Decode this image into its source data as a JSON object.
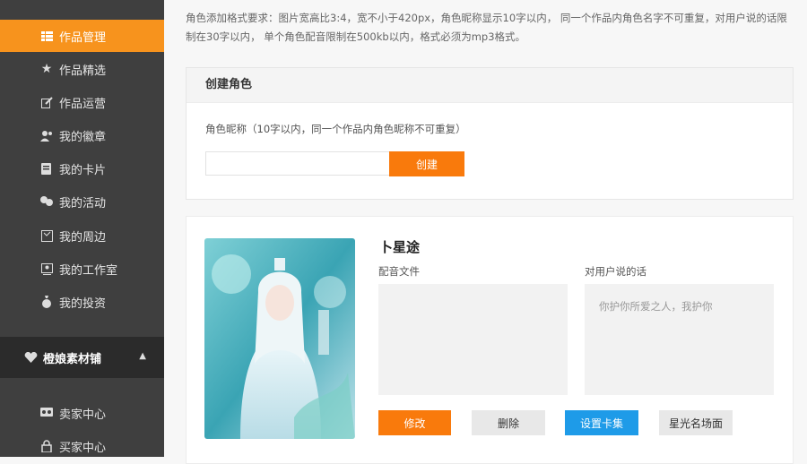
{
  "sidebar": {
    "items": [
      {
        "label": "作品管理",
        "icon": "grid-list-icon",
        "active": true
      },
      {
        "label": "作品精选",
        "icon": "star-icon"
      },
      {
        "label": "作品运营",
        "icon": "edit-icon"
      },
      {
        "label": "我的徽章",
        "icon": "badge-icon"
      },
      {
        "label": "我的卡片",
        "icon": "card-icon"
      },
      {
        "label": "我的活动",
        "icon": "activity-icon"
      },
      {
        "label": "我的周边",
        "icon": "merch-icon"
      },
      {
        "label": "我的工作室",
        "icon": "studio-icon"
      },
      {
        "label": "我的投资",
        "icon": "money-bag-icon"
      }
    ],
    "section": {
      "label": "橙娘素材铺",
      "icon": "heart-icon",
      "caret": "▲"
    },
    "sub_items": [
      {
        "label": "卖家中心",
        "icon": "seller-icon"
      },
      {
        "label": "买家中心",
        "icon": "lock-icon"
      }
    ],
    "accent_color": "#f7931d"
  },
  "main": {
    "note": "角色添加格式要求：图片宽高比3:4，宽不小于420px，角色昵称显示10字以内，  同一个作品内角色名字不可重复，对用户说的话限制在30字以内，  单个角色配音限制在500kb以内，格式必须为mp3格式。",
    "create_panel": {
      "title": "创建角色",
      "field_label": "角色昵称（10字以内，同一个作品内角色昵称不可重复）",
      "input_value": "",
      "button_label": "创建"
    },
    "role": {
      "name": "卜星途",
      "audio_label": "配音文件",
      "speech_label": "对用户说的话",
      "speech_text": "你护你所爱之人，我护你",
      "buttons": {
        "edit": "修改",
        "delete": "删除",
        "set_card": "设置卡集",
        "star_scene": "星光名场面"
      },
      "colors": {
        "primary": "#f97a0c",
        "info": "#1e9be8",
        "neutral": "#e8e8e8"
      }
    }
  }
}
